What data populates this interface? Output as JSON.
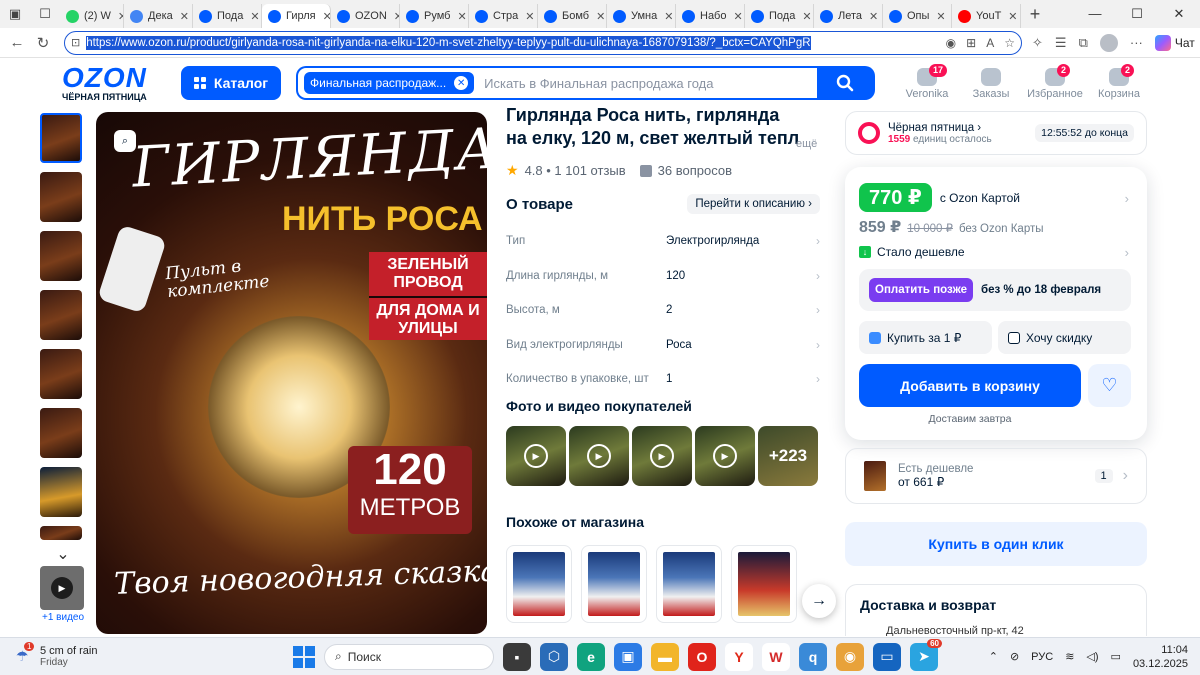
{
  "browser": {
    "tabs": [
      {
        "label": "(2) W",
        "icon": "whatsapp-favicon",
        "color": "#25d366"
      },
      {
        "label": "Дека",
        "icon": "docs-favicon",
        "color": "#4285f4"
      },
      {
        "label": "Пода",
        "icon": "ozon-favicon",
        "color": "#005bff"
      },
      {
        "label": "Гирля",
        "icon": "ozon-favicon",
        "color": "#005bff",
        "active": true
      },
      {
        "label": "OZON",
        "icon": "ozon-favicon",
        "color": "#005bff"
      },
      {
        "label": "Румб",
        "icon": "ozon-favicon",
        "color": "#005bff"
      },
      {
        "label": "Стра",
        "icon": "ozon-favicon",
        "color": "#005bff"
      },
      {
        "label": "Бомб",
        "icon": "ozon-favicon",
        "color": "#005bff"
      },
      {
        "label": "Умна",
        "icon": "ozon-favicon",
        "color": "#005bff"
      },
      {
        "label": "Набо",
        "icon": "ozon-favicon",
        "color": "#005bff"
      },
      {
        "label": "Пода",
        "icon": "ozon-favicon",
        "color": "#005bff"
      },
      {
        "label": "Лета",
        "icon": "ozon-favicon",
        "color": "#005bff"
      },
      {
        "label": "Опы",
        "icon": "ozon-favicon",
        "color": "#005bff"
      },
      {
        "label": "YouT",
        "icon": "youtube-favicon",
        "color": "#ff0000"
      }
    ],
    "url": "https://www.ozon.ru/product/girlyanda-rosa-nit-girlyanda-na-elku-120-m-svet-zheltyy-teplyy-pult-du-ulichnaya-1687079138/?_bctx=CAYQhPgR",
    "copilot_label": "Чат"
  },
  "header": {
    "logo": "OZON",
    "logo_sub": "ЧЁРНАЯ ПЯТНИЦА",
    "catalog_label": "Каталог",
    "search_chip": "Финальная распродаж...",
    "search_placeholder": "Искать в Финальная распродажа года",
    "items": [
      {
        "label": "Veronika",
        "badge": "17"
      },
      {
        "label": "Заказы",
        "badge": ""
      },
      {
        "label": "Избранное",
        "badge": "2"
      },
      {
        "label": "Корзина",
        "badge": "2"
      }
    ]
  },
  "gallery": {
    "video_label": "+1 видео",
    "image_text": {
      "line1": "ГИРЛЯНДА",
      "line2": "НИТЬ РОСА",
      "pult": "Пульт в комплекте",
      "green": "ЗЕЛЕНЫЙ ПРОВОД",
      "home": "ДЛЯ ДОМА И УЛИЦЫ",
      "num": "120",
      "unit": "МЕТРОВ",
      "slogan": "Твоя новогодняя сказка!"
    }
  },
  "product": {
    "title": "Гирлянда Роса нить, гирлянда на елку, 120 м, свет желтый тепл",
    "title_more": "ещё",
    "rating": "4.8 • 1 101 отзыв",
    "questions": "36 вопросов",
    "about_title": "О товаре",
    "about_link": "Перейти к описанию",
    "specs": [
      {
        "key": "Тип",
        "value": "Электрогирлянда"
      },
      {
        "key": "Длина гирлянды, м",
        "value": "120"
      },
      {
        "key": "Высота, м",
        "value": "2"
      },
      {
        "key": "Вид электрогирлянды",
        "value": "Роса"
      },
      {
        "key": "Количество в упаковке, шт",
        "value": "1"
      }
    ],
    "photos_title": "Фото и видео покупателей",
    "photos_more": "+223",
    "similar_title": "Похоже от магазина"
  },
  "promo": {
    "title": "Чёрная пятница",
    "count": "1559",
    "left_text": "единиц осталось",
    "timer": "12:55:52 до конца"
  },
  "buy": {
    "price": "770 ₽",
    "price_note": "с Ozon Картой",
    "price2": "859 ₽",
    "price_old": "10 000 ₽",
    "price2_note": "без Ozon Карты",
    "cheaper": "Стало дешевле",
    "pay_later_btn": "Оплатить позже",
    "pay_later_note": "без % до 18 февраля",
    "buy_for_1": "Купить за 1 ₽",
    "want_discount": "Хочу скидку",
    "add_to_cart": "Добавить в корзину",
    "delivery_note": "Доставим завтра"
  },
  "cheaper_box": {
    "t1": "Есть дешевле",
    "t2": "от 661 ₽",
    "count": "1"
  },
  "one_click": "Купить в один клик",
  "delivery": {
    "title": "Доставка и возврат",
    "addr": "Дальневосточный пр-кт, 42"
  },
  "taskbar": {
    "weather_badge": "1",
    "weather_t1": "5 cm of rain",
    "weather_t2": "Friday",
    "search": "Поиск",
    "telegram_badge": "60",
    "lang": "РУС",
    "time": "11:04",
    "date": "03.12.2025"
  }
}
